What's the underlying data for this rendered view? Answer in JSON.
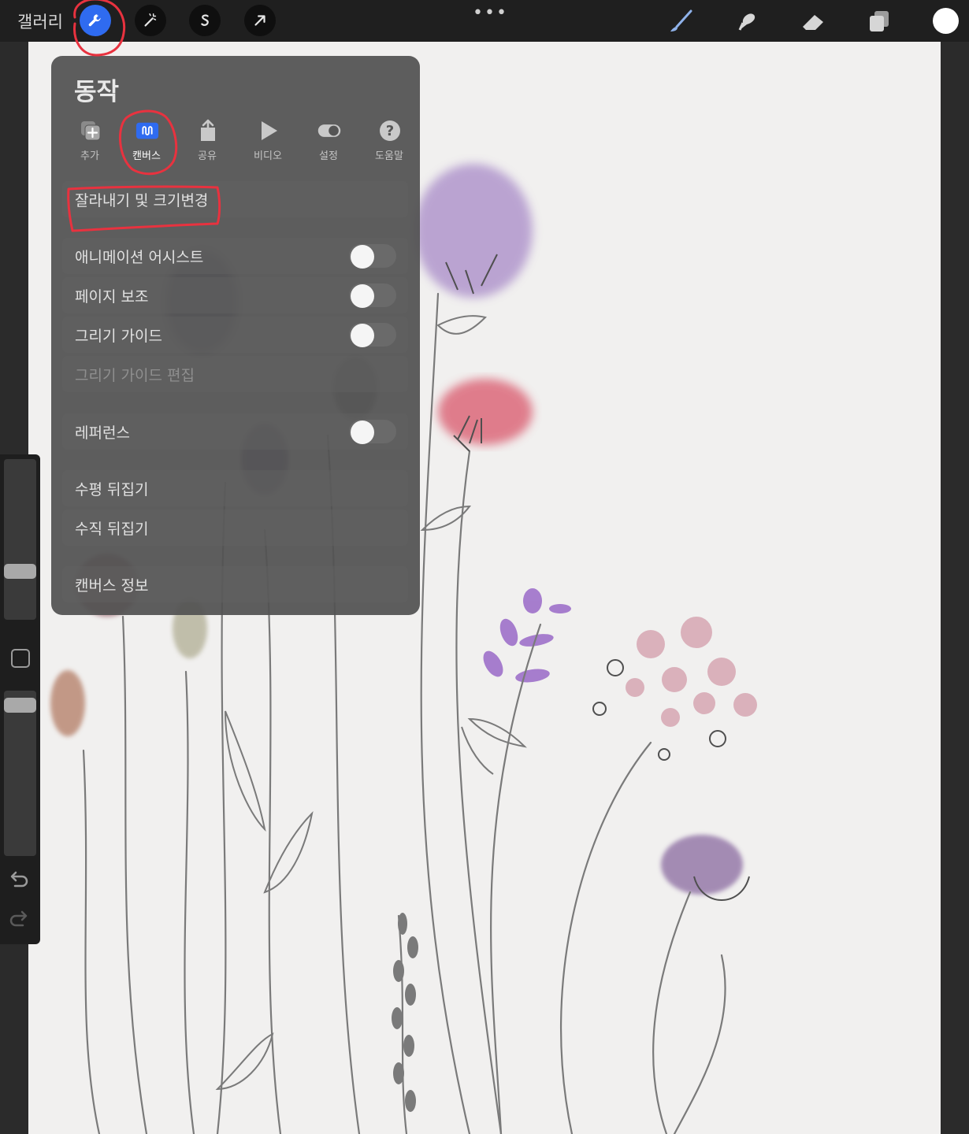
{
  "toolbar": {
    "gallery_label": "갤러리",
    "left_tools": [
      "wrench-icon",
      "magic-wand-icon",
      "selection-s-icon",
      "arrow-move-icon"
    ],
    "right_tools": [
      "brush-icon",
      "smudge-icon",
      "eraser-icon",
      "layers-icon"
    ],
    "more_label": "•••",
    "current_color": "#ffffff"
  },
  "panel": {
    "title": "동작",
    "tabs": [
      {
        "label": "추가",
        "icon": "add-icon"
      },
      {
        "label": "캔버스",
        "icon": "canvas-icon",
        "active": true
      },
      {
        "label": "공유",
        "icon": "share-icon"
      },
      {
        "label": "비디오",
        "icon": "play-icon"
      },
      {
        "label": "설정",
        "icon": "toggle-icon"
      },
      {
        "label": "도움말",
        "icon": "help-icon"
      }
    ],
    "items": {
      "crop": "잘라내기 및 크기변경",
      "animation_assist": "애니메이션 어시스트",
      "page_assist": "페이지 보조",
      "drawing_guide": "그리기 가이드",
      "edit_drawing_guide": "그리기 가이드 편집",
      "reference": "레퍼런스",
      "flip_horizontal": "수평 뒤집기",
      "flip_vertical": "수직 뒤집기",
      "canvas_info": "캔버스 정보"
    },
    "toggles": {
      "animation_assist": false,
      "page_assist": false,
      "drawing_guide": false,
      "reference": false
    }
  },
  "colors": {
    "accent": "#2f6bf0",
    "annotation": "#e8323f",
    "canvas": "#f1f0ef"
  }
}
